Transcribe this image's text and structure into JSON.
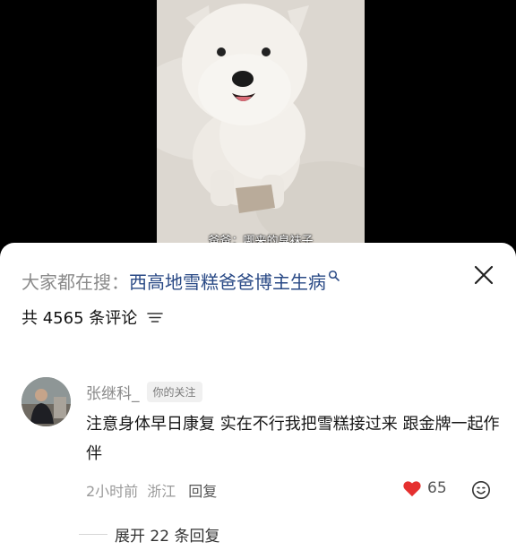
{
  "video": {
    "subtitle": "爸爸：哪来的臭袜子"
  },
  "search_bar": {
    "prefix": "大家都在搜：",
    "keyword": "西高地雪糕爸爸博主生病",
    "icon": "search-icon"
  },
  "close_icon": "close-icon",
  "comments_header": {
    "count_text": "共 4565 条评论",
    "sort_icon": "sort-icon"
  },
  "comment": {
    "author": "张继科_",
    "badge": "你的关注",
    "text": "注意身体早日康复 实在不行我把雪糕接过来 跟金牌一起作伴",
    "time": "2小时前",
    "location": "浙江",
    "reply_label": "回复",
    "like_count": "65",
    "like_color": "#e5302f",
    "liked": true
  },
  "replies": {
    "expand_label": "展开 22 条回复"
  }
}
